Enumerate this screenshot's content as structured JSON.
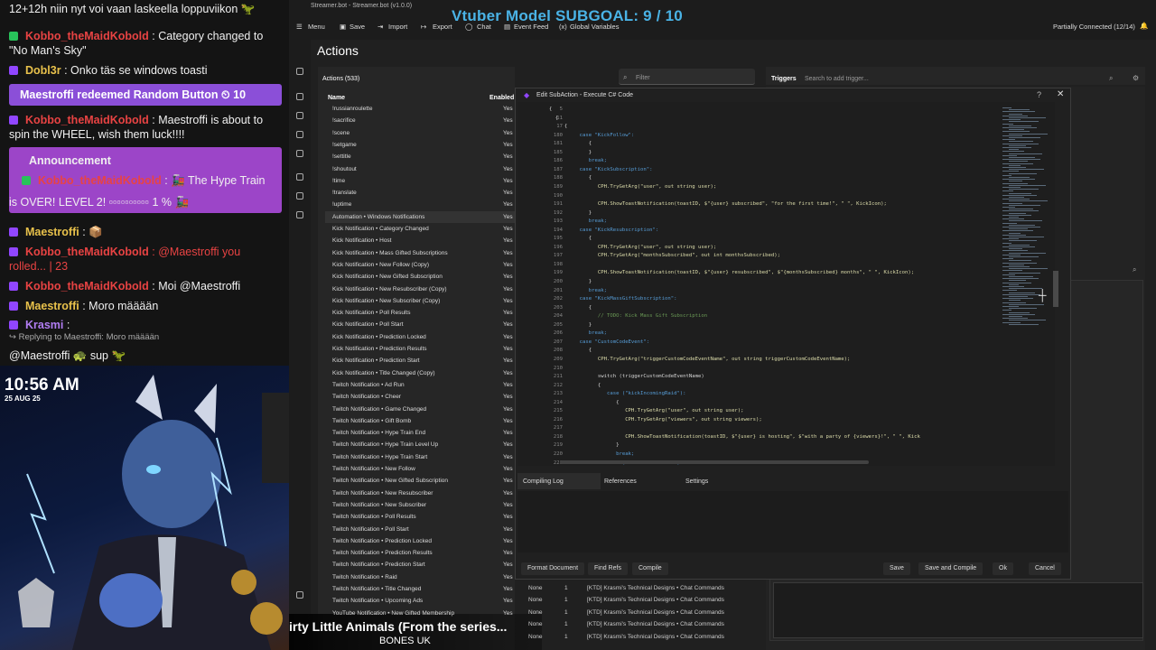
{
  "chat": {
    "lines": [
      {
        "text": "12+12h niin nyt voi vaan laskeella loppuviikon 🦖",
        "user": "",
        "badge": ""
      },
      {
        "user": "Kobbo_theMaidKobold",
        "text": ": Category changed to",
        "cont": "\"No Man's Sky\""
      },
      {
        "user": "Dobl3r",
        "text": ": Onko täs se windows toasti"
      },
      {
        "user": "Kobbo_theMaidKobold",
        "text": ": Maestroffi is about to",
        "cont": "spin the WHEEL, wish them luck!!!!"
      },
      {
        "user": "Maestroffi",
        "text": ": 📦"
      },
      {
        "user": "Kobbo_theMaidKobold",
        "text": ": @Maestroffi you",
        "cont": "rolled... | 23"
      },
      {
        "user": "Kobbo_theMaidKobold",
        "text": ": Moi @Maestroffi"
      },
      {
        "user": "Maestroffi",
        "text": ": Moro määään"
      },
      {
        "user": "Krasmi",
        "text": ":"
      },
      {
        "user": "",
        "text": "@Maestroffi 🐢 sup 🦖"
      }
    ],
    "redeem": "Maestroffi redeemed Random Button ⏲ 10",
    "announcement": {
      "title": "Announcement",
      "user": "Kobbo_theMaidKobold",
      "text": ": 🚂 The Hype Train",
      "cont": "is OVER! LEVEL 2! ▫▫▫▫▫▫▫▫▫▫ 1 % 🚂"
    },
    "reply_note": "↪ Replying to Maestroffi: Moro määään"
  },
  "cam": {
    "clock": "10:56 AM",
    "date": "25 AUG 25"
  },
  "app": {
    "title": "Streamer.bot - Streamer.bot (v1.0.0)",
    "toolbar": [
      "Menu",
      "Save",
      "Import",
      "Export",
      "Chat",
      "Event Feed",
      "Global Variables"
    ],
    "subgoal": "Vtuber Model SUBGOAL: 9 / 10",
    "connection": "Partially Connected (12/14)",
    "page_title": "Actions",
    "actions_count": "Actions (533)",
    "filter_placeholder": "Filter",
    "columns": {
      "name": "Name",
      "enabled": "Enabled"
    },
    "actions": [
      "!russianroulette",
      "!sacrifice",
      "!scene",
      "!setgame",
      "!settitle",
      "!shoutout",
      "!time",
      "!translate",
      "!uptime",
      "Automation • Windows Notifications",
      "Kick Notification • Category Changed",
      "Kick Notification • Host",
      "Kick Notification • Mass Gifted Subscriptions",
      "Kick Notification • New Follow (Copy)",
      "Kick Notification • New Gifted Subscription",
      "Kick Notification • New Resubscriber (Copy)",
      "Kick Notification • New Subscriber (Copy)",
      "Kick Notification • Poll Results",
      "Kick Notification • Poll Start",
      "Kick Notification • Prediction Locked",
      "Kick Notification • Prediction Results",
      "Kick Notification • Prediction Start",
      "Kick Notification • Title Changed (Copy)",
      "Twitch Notification • Ad Run",
      "Twitch Notification • Cheer",
      "Twitch Notification • Game Changed",
      "Twitch Notification • Gift Bomb",
      "Twitch Notification • Hype Train End",
      "Twitch Notification • Hype Train Level Up",
      "Twitch Notification • Hype Train Start",
      "Twitch Notification • New Follow",
      "Twitch Notification • New Gifted Subscription",
      "Twitch Notification • New Resubscriber",
      "Twitch Notification • New Subscriber",
      "Twitch Notification • Poll Results",
      "Twitch Notification • Poll Start",
      "Twitch Notification • Prediction Locked",
      "Twitch Notification • Prediction Results",
      "Twitch Notification • Prediction Start",
      "Twitch Notification • Raid",
      "Twitch Notification • Title Changed",
      "Twitch Notification • Upcoming Ads",
      "YouTube Notification • New Gifted Membership"
    ],
    "enabled_value": "Yes",
    "triggers_label": "Triggers",
    "trigger_search": "Search to add trigger...",
    "subaction_rows": [
      {
        "type": "None",
        "n": "1",
        "name": "[KTD] Krasmi's Technical Designs • Chat Commands"
      },
      {
        "type": "None",
        "n": "1",
        "name": "[KTD] Krasmi's Technical Designs • Chat Commands"
      },
      {
        "type": "None",
        "n": "1",
        "name": "[KTD] Krasmi's Technical Designs • Chat Commands"
      },
      {
        "type": "None",
        "n": "1",
        "name": "[KTD] Krasmi's Technical Designs • Chat Commands"
      },
      {
        "type": "None",
        "n": "1",
        "name": "[KTD] Krasmi's Technical Designs • Chat Commands"
      }
    ]
  },
  "dialog": {
    "title": "Edit SubAction - Execute C# Code",
    "code": [
      {
        "ln": "5",
        "code": "{"
      },
      {
        "ln": "11",
        "code": "  {"
      },
      {
        "ln": "17",
        "code": "     {"
      },
      {
        "ln": "180",
        "code": "          case \"KickFollow\":"
      },
      {
        "ln": "181",
        "code": "             {"
      },
      {
        "ln": "185",
        "code": "             }"
      },
      {
        "ln": "186",
        "code": "             break;"
      },
      {
        "ln": "187",
        "code": "          case \"KickSubscription\":"
      },
      {
        "ln": "188",
        "code": "             {"
      },
      {
        "ln": "189",
        "code": "                CPH.TryGetArg(\"user\", out string user);"
      },
      {
        "ln": "190",
        "code": ""
      },
      {
        "ln": "191",
        "code": "                CPH.ShowToastNotification(toastID, $\"{user} subscribed\", \"for the first time!\", \" \", KickIcon);"
      },
      {
        "ln": "192",
        "code": "             }"
      },
      {
        "ln": "193",
        "code": "             break;"
      },
      {
        "ln": "194",
        "code": "          case \"KickResubscription\":"
      },
      {
        "ln": "195",
        "code": "             {"
      },
      {
        "ln": "196",
        "code": "                CPH.TryGetArg(\"user\", out string user);"
      },
      {
        "ln": "197",
        "code": "                CPH.TryGetArg(\"monthsSubscribed\", out int monthsSubscribed);"
      },
      {
        "ln": "198",
        "code": ""
      },
      {
        "ln": "199",
        "code": "                CPH.ShowToastNotification(toastID, $\"{user} resubscribed\", $\"{monthsSubscribed} months\", \" \", KickIcon);"
      },
      {
        "ln": "200",
        "code": "             }"
      },
      {
        "ln": "201",
        "code": "             break;"
      },
      {
        "ln": "202",
        "code": "          case \"KickMassGiftSubscription\":"
      },
      {
        "ln": "203",
        "code": "             {"
      },
      {
        "ln": "204",
        "code": "                // TODO: Kick Mass Gift Subscription"
      },
      {
        "ln": "205",
        "code": "             }"
      },
      {
        "ln": "206",
        "code": "             break;"
      },
      {
        "ln": "207",
        "code": "          case \"CustomCodeEvent\":"
      },
      {
        "ln": "208",
        "code": "             {"
      },
      {
        "ln": "209",
        "code": "                CPH.TryGetArg(\"triggerCustomCodeEventName\", out string triggerCustomCodeEventName);"
      },
      {
        "ln": "210",
        "code": ""
      },
      {
        "ln": "211",
        "code": "                switch (triggerCustomCodeEventName)"
      },
      {
        "ln": "212",
        "code": "                {"
      },
      {
        "ln": "213",
        "code": "                   case (\"kickIncomingRaid\"):"
      },
      {
        "ln": "214",
        "code": "                      {"
      },
      {
        "ln": "215",
        "code": "                         CPH.TryGetArg(\"user\", out string user);"
      },
      {
        "ln": "216",
        "code": "                         CPH.TryGetArg(\"viewers\", out string viewers);"
      },
      {
        "ln": "217",
        "code": ""
      },
      {
        "ln": "218",
        "code": "                         CPH.ShowToastNotification(toastID, $\"{user} is hosting\", $\"with a party of {viewers}!\", \" \", Kick"
      },
      {
        "ln": "219",
        "code": "                      }"
      },
      {
        "ln": "220",
        "code": "                      break;"
      },
      {
        "ln": "221",
        "code": "                   case (\"kickPollCreated\"):"
      }
    ],
    "tabs": [
      "Compiling Log",
      "References",
      "Settings"
    ],
    "buttons_left": [
      "Format Document",
      "Find Refs",
      "Compile"
    ],
    "buttons_right": [
      "Save",
      "Save and Compile",
      "Ok",
      "Cancel"
    ]
  },
  "music": {
    "title": "irty Little Animals (From the series...",
    "artist": "BONES UK"
  },
  "colors": {
    "accent": "#9146ff",
    "subgoal": "#4ab3e6",
    "user_red": "#e84343",
    "user_yellow": "#e8c14b"
  }
}
